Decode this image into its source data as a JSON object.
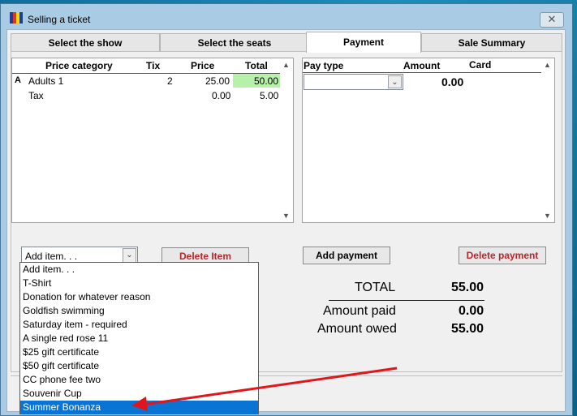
{
  "window": {
    "title": "Selling a ticket",
    "close_glyph": "✕"
  },
  "tabs": [
    {
      "label": "Select the show"
    },
    {
      "label": "Select the seats"
    },
    {
      "label": "Payment"
    },
    {
      "label": "Sale Summary"
    }
  ],
  "items_grid": {
    "headers": {
      "category": "Price category",
      "tix": "Tix",
      "price": "Price",
      "total": "Total"
    },
    "rows": [
      {
        "marker": "A",
        "category": "Adults 1",
        "tix": "2",
        "price": "25.00",
        "total": "50.00"
      },
      {
        "marker": "",
        "category": "Tax",
        "tix": "",
        "price": "0.00",
        "total": "5.00"
      }
    ],
    "highlight_color": "#b7f0a8"
  },
  "payment_grid": {
    "headers": {
      "pay_type": "Pay type",
      "amount": "Amount",
      "card": "Card"
    },
    "row_amount": "0.00"
  },
  "add_item": {
    "selected": "Add item. . .",
    "options": [
      "Add item. . .",
      "T-Shirt",
      "Donation for whatever reason",
      "Goldfish swimming",
      "Saturday item - required",
      "A single red rose 11",
      "$25 gift certificate",
      "$50 gift certificate",
      "CC phone fee two",
      "Souvenir Cup",
      "Summer Bonanza"
    ],
    "highlighted_index": 10
  },
  "buttons": {
    "delete_item": "Delete Item",
    "add_payment": "Add payment",
    "delete_payment": "Delete payment"
  },
  "totals": {
    "total_label": "TOTAL",
    "total_value": "55.00",
    "paid_label": "Amount paid",
    "paid_value": "0.00",
    "owed_label": "Amount owed",
    "owed_value": "55.00"
  },
  "colors": {
    "accent_red": "#b8262b",
    "selection_blue": "#0a74d4",
    "annotation_arrow": "#e0161b"
  }
}
